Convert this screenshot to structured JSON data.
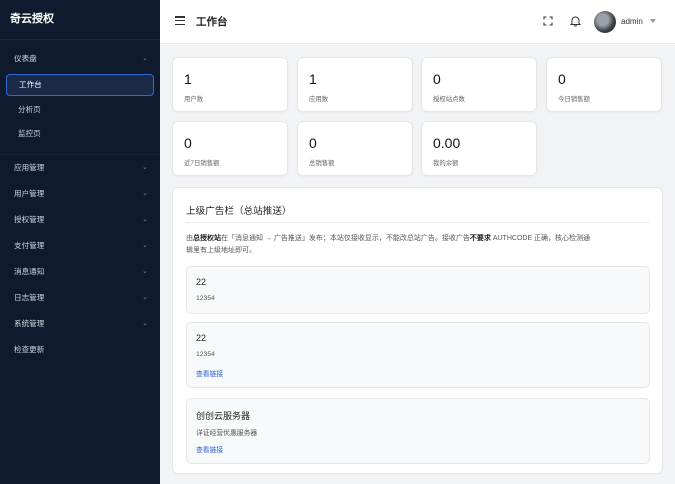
{
  "sidebar": {
    "brand": "奇云授权",
    "dashboard": {
      "label": "仪表盘",
      "children": [
        "工作台",
        "分析页",
        "监控页"
      ]
    },
    "items": [
      {
        "label": "应用管理"
      },
      {
        "label": "用户管理"
      },
      {
        "label": "授权管理"
      },
      {
        "label": "支付管理"
      },
      {
        "label": "消息通知"
      },
      {
        "label": "日志管理"
      },
      {
        "label": "系统管理"
      },
      {
        "label": "检查更新"
      }
    ]
  },
  "header": {
    "title": "工作台",
    "username": "admin"
  },
  "stats": [
    {
      "value": "1",
      "label": "用户数"
    },
    {
      "value": "1",
      "label": "应用数"
    },
    {
      "value": "0",
      "label": "授权站点数"
    },
    {
      "value": "0",
      "label": "今日销售额"
    },
    {
      "value": "0",
      "label": "近7日销售额"
    },
    {
      "value": "0",
      "label": "总销售额"
    },
    {
      "value": "0.00",
      "label": "我的余额"
    }
  ],
  "ads": {
    "title": "上级广告栏（总站推送）",
    "notice": {
      "p1": "由",
      "b1": "总授权站",
      "p2": "在「消息通知 → 广告推送」发布；本站仅接收显示，不能改总站广告。接收广告",
      "b2": "不要求",
      "p3": " AUTHCODE 正确，核心检测通",
      "p4": "辑里有上级地址即可。"
    },
    "items": [
      {
        "title": "22",
        "desc": "12354",
        "link": ""
      },
      {
        "title": "22",
        "desc": "12354",
        "link": "查看链接"
      },
      {
        "title": "创创云服务器",
        "desc": "详证经营优惠服务器",
        "link": "查看链接"
      }
    ]
  }
}
